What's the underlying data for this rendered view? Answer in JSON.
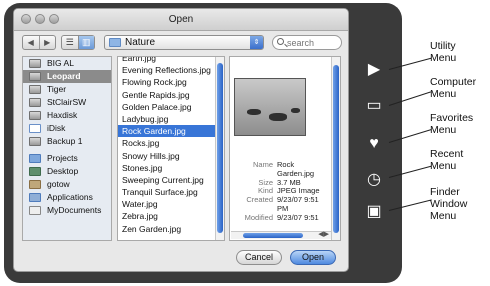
{
  "dialog": {
    "title": "Open",
    "location": "Nature",
    "search_placeholder": "search",
    "nav_back": "◀",
    "nav_forward": "▶",
    "view_list": "☰",
    "view_columns": "▥",
    "cancel_label": "Cancel",
    "open_label": "Open"
  },
  "sidebar": {
    "devices": [
      {
        "label": "BIG AL",
        "icon": "hard-drive-icon"
      },
      {
        "label": "Leopard",
        "icon": "hard-drive-icon",
        "selected": true
      },
      {
        "label": "Tiger",
        "icon": "hard-drive-icon"
      },
      {
        "label": "StClairSW",
        "icon": "hard-drive-icon"
      },
      {
        "label": "Haxdisk",
        "icon": "hard-drive-icon"
      },
      {
        "label": "iDisk",
        "icon": "idisk-icon"
      },
      {
        "label": "Backup 1",
        "icon": "hard-drive-icon"
      }
    ],
    "places": [
      {
        "label": "Projects",
        "icon": "folder-icon"
      },
      {
        "label": "Desktop",
        "icon": "desktop-icon"
      },
      {
        "label": "gotow",
        "icon": "home-icon"
      },
      {
        "label": "Applications",
        "icon": "applications-icon"
      },
      {
        "label": "MyDocuments",
        "icon": "documents-icon"
      }
    ]
  },
  "files": [
    "Earth.jpg",
    "Evening Reflections.jpg",
    "Flowing Rock.jpg",
    "Gentle Rapids.jpg",
    "Golden Palace.jpg",
    "Ladybug.jpg",
    "Rock Garden.jpg",
    "Rocks.jpg",
    "Snowy Hills.jpg",
    "Stones.jpg",
    "Sweeping Current.jpg",
    "Tranquil Surface.jpg",
    "Water.jpg",
    "Zebra.jpg",
    "Zen Garden.jpg"
  ],
  "selected_file": "Rock Garden.jpg",
  "preview": {
    "rows": [
      {
        "key": "Name",
        "value": "Rock"
      },
      {
        "key": "",
        "value": "Garden.jpg"
      },
      {
        "key": "Size",
        "value": "3.7 MB"
      },
      {
        "key": "Kind",
        "value": "JPEG Image"
      },
      {
        "key": "Created",
        "value": "9/23/07 9:51"
      },
      {
        "key": "",
        "value": "PM"
      },
      {
        "key": "Modified",
        "value": "9/23/07 9:51"
      }
    ]
  },
  "callouts": {
    "utility": "Utility\nMenu",
    "computer": "Computer\nMenu",
    "favorites": "Favorites\nMenu",
    "recent": "Recent\nMenu",
    "finder": "Finder\nWindow\nMenu"
  },
  "side_icons": {
    "utility": "▶",
    "computer": "▭",
    "favorites": "♥",
    "recent": "◷",
    "finder": "▣"
  },
  "colors": {
    "frame": "#3a3a3a",
    "selection": "#3875d7",
    "sidebar_selection": "#8b8b8b"
  }
}
